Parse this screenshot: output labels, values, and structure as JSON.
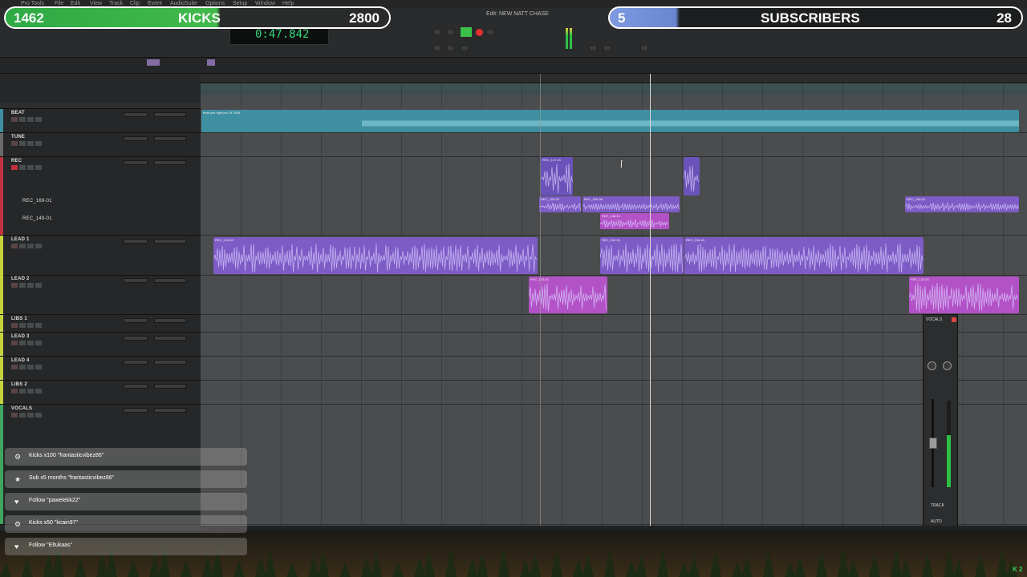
{
  "window": {
    "title": "Edit: NEW NATT CHASE",
    "menu": [
      "Pro Tools",
      "File",
      "Edit",
      "View",
      "Track",
      "Clip",
      "Event",
      "AudioSuite",
      "Options",
      "Setup",
      "Window",
      "Help"
    ],
    "counter": "0:47.842"
  },
  "overlay": {
    "kicks": {
      "current": "1462",
      "label": "KICKS",
      "goal": "2800"
    },
    "subscribers": {
      "current": "5",
      "label": "SUBSCRIBERS",
      "goal": "28"
    }
  },
  "tracks": [
    {
      "name": "BEAT",
      "color": "#3e8fa0"
    },
    {
      "name": "TUNE",
      "color": "#6a6a6a"
    },
    {
      "name": "REC",
      "color": "#c23140",
      "sublanes": [
        "REC_169-01",
        "REC_149-01"
      ]
    },
    {
      "name": "LEAD 1",
      "color": "#c5d23e"
    },
    {
      "name": "LEAD 2",
      "color": "#c5d23e"
    },
    {
      "name": "LIBS 1",
      "color": "#c5d23e"
    },
    {
      "name": "LEAD 3",
      "color": "#c5d23e"
    },
    {
      "name": "LEAD 4",
      "color": "#c5d23e"
    },
    {
      "name": "LIBS 2",
      "color": "#c5d23e"
    },
    {
      "name": "VOCALS",
      "color": "#3fa55f"
    }
  ],
  "clips": {
    "beat": "beat you right jan 24 2026",
    "rec_1": "REC_147-01",
    "rec_2": "REC_106-03",
    "rec_3": "REC_160-06",
    "rec_4": "REC_148-01",
    "rec_5": "REC_160-01",
    "lead1_a": "REC_106-02",
    "lead1_b": "REC_152-01",
    "lead1_c": "REC_106-05",
    "lead2_a": "REC_133-01",
    "lead2_b": "REC_123-01"
  },
  "mixer": {
    "name": "VOCALS",
    "track_label": "TRACK",
    "auto_label": "AUTO"
  },
  "alerts": [
    {
      "icon": "gear",
      "text": "Kicks x100 \"frantasticvibez86\""
    },
    {
      "icon": "star",
      "text": "Sub x5 months \"frantasticvibez86\""
    },
    {
      "icon": "heart",
      "text": "Follow \"pawelekk22\""
    },
    {
      "icon": "gear",
      "text": "Kicks x50 \"kcain97\""
    },
    {
      "icon": "heart",
      "text": "Follow \"Eltukaas\""
    }
  ],
  "badge": "K 2"
}
